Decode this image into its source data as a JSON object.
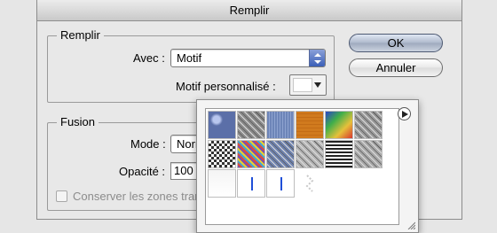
{
  "dialog": {
    "title": "Remplir",
    "remplir_group": {
      "label": "Remplir",
      "avec_label": "Avec :",
      "avec_value": "Motif",
      "motif_label": "Motif personnalisé :"
    },
    "fusion_group": {
      "label": "Fusion",
      "mode_label": "Mode :",
      "mode_value": "Normal",
      "opacite_label": "Opacité :",
      "opacite_value": "100",
      "conserver_label": "Conserver les zones transparentes"
    },
    "buttons": {
      "ok": "OK",
      "annuler": "Annuler"
    }
  },
  "pattern_picker": {
    "patterns": [
      {
        "name": "bubbles",
        "color": "#5b6fa8"
      },
      {
        "name": "wrinkle",
        "color": "#8a8a8a"
      },
      {
        "name": "blue-vertical",
        "color": "#6d85b8"
      },
      {
        "name": "orange-woodgrain",
        "color": "#d07a1e"
      },
      {
        "name": "rainbow-tie-dye",
        "color": "#3fae4a"
      },
      {
        "name": "gray-marble",
        "color": "#9a9a9a"
      },
      {
        "name": "black-white-checks",
        "color": "#333333"
      },
      {
        "name": "multicolor-noise",
        "color": "#7b4fb0"
      },
      {
        "name": "blue-noise",
        "color": "#6f83b0"
      },
      {
        "name": "gray-noise",
        "color": "#b5b5b5"
      },
      {
        "name": "black-white-weave",
        "color": "#222222"
      },
      {
        "name": "granite",
        "color": "#a8a8a8"
      },
      {
        "name": "white-light",
        "color": "#f4f4f4"
      },
      {
        "name": "blue-line-thin",
        "color": "#1f4fd8"
      },
      {
        "name": "blue-line",
        "color": "#1f4fd8"
      },
      {
        "name": "dotted-chevron",
        "color": "#cfcfcf"
      }
    ]
  },
  "colors": {
    "dialog_bg": "#e8e8e8",
    "default_button": "#aeb9cc",
    "select_arrows": "#3b5fb8"
  }
}
